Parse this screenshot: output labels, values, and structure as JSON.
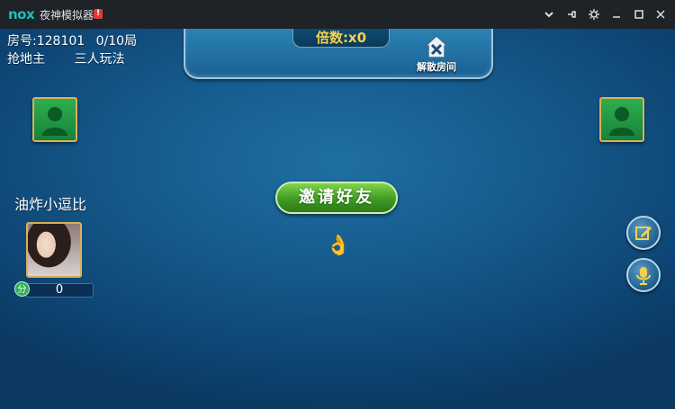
{
  "titlebar": {
    "logo": "nox",
    "title": "夜神模拟器",
    "badge": "!",
    "buttons": [
      "chevron-down-icon",
      "pin-icon",
      "gear-icon",
      "minimize-icon",
      "maximize-icon",
      "close-icon"
    ]
  },
  "room": {
    "room_no_label": "房号:128101",
    "rounds": "0/10局",
    "mode": "抢地主",
    "players": "三人玩法"
  },
  "top_panel": {
    "multiplier": "倍数:x0",
    "dissolve_label": "解散房间"
  },
  "player": {
    "name": "油炸小逗比",
    "score_icon": "分",
    "score": "0"
  },
  "invite": {
    "label": "邀请好友"
  },
  "ok_hand": "👌",
  "colors": {
    "accent_gold": "#f5d24b",
    "invite_green": "#3e9a22",
    "seat_green": "#2fae4d",
    "frame_gold": "#d8b05a",
    "table_blue": "#165c8e"
  }
}
